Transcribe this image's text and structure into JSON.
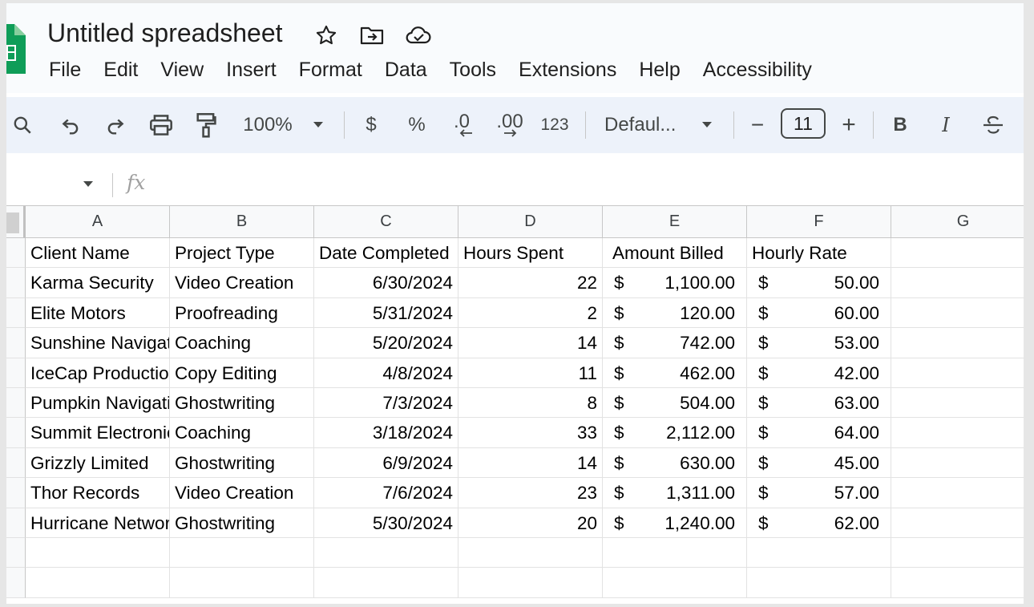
{
  "app": {
    "title": "Untitled spreadsheet",
    "menu": [
      "File",
      "Edit",
      "View",
      "Insert",
      "Format",
      "Data",
      "Tools",
      "Extensions",
      "Help",
      "Accessibility"
    ]
  },
  "toolbar": {
    "zoom": "100%",
    "currency_label": "$",
    "percent_label": "%",
    "decrease_decimal_label": ".0",
    "increase_decimal_label": ".00",
    "format_more_label": "123",
    "font_family": "Defaul...",
    "font_size": "11",
    "decrease_size_label": "−",
    "increase_size_label": "+",
    "bold_label": "B",
    "italic_label": "I"
  },
  "formula_bar": {
    "fx_label": "fx",
    "value": ""
  },
  "sheet": {
    "columns": [
      "A",
      "B",
      "C",
      "D",
      "E",
      "F",
      "G"
    ],
    "header_row": [
      "Client Name",
      "Project Type",
      "Date Completed",
      "Hours Spent",
      "Amount Billed",
      "Hourly Rate"
    ],
    "rows": [
      {
        "client": "Karma Security",
        "type": "Video Creation",
        "date": "6/30/2024",
        "hours": "22",
        "amount": "1,100.00",
        "rate": "50.00"
      },
      {
        "client": "Elite Motors",
        "type": "Proofreading",
        "date": "5/31/2024",
        "hours": "2",
        "amount": "120.00",
        "rate": "60.00"
      },
      {
        "client": "Sunshine Navigation",
        "type": "Coaching",
        "date": "5/20/2024",
        "hours": "14",
        "amount": "742.00",
        "rate": "53.00"
      },
      {
        "client": "IceCap Productions",
        "type": "Copy Editing",
        "date": "4/8/2024",
        "hours": "11",
        "amount": "462.00",
        "rate": "42.00"
      },
      {
        "client": "Pumpkin Navigation",
        "type": "Ghostwriting",
        "date": "7/3/2024",
        "hours": "8",
        "amount": "504.00",
        "rate": "63.00"
      },
      {
        "client": "Summit Electronics",
        "type": "Coaching",
        "date": "3/18/2024",
        "hours": "33",
        "amount": "2,112.00",
        "rate": "64.00"
      },
      {
        "client": "Grizzly Limited",
        "type": "Ghostwriting",
        "date": "6/9/2024",
        "hours": "14",
        "amount": "630.00",
        "rate": "45.00"
      },
      {
        "client": "Thor Records",
        "type": "Video Creation",
        "date": "7/6/2024",
        "hours": "23",
        "amount": "1,311.00",
        "rate": "57.00"
      },
      {
        "client": "Hurricane Network",
        "type": "Ghostwriting",
        "date": "5/30/2024",
        "hours": "20",
        "amount": "1,240.00",
        "rate": "62.00"
      }
    ],
    "currency_symbol": "$"
  },
  "colors": {
    "brand_green": "#0f9d58",
    "toolbar_bg": "#edf2fa",
    "header_bg": "#f9fbfd"
  }
}
